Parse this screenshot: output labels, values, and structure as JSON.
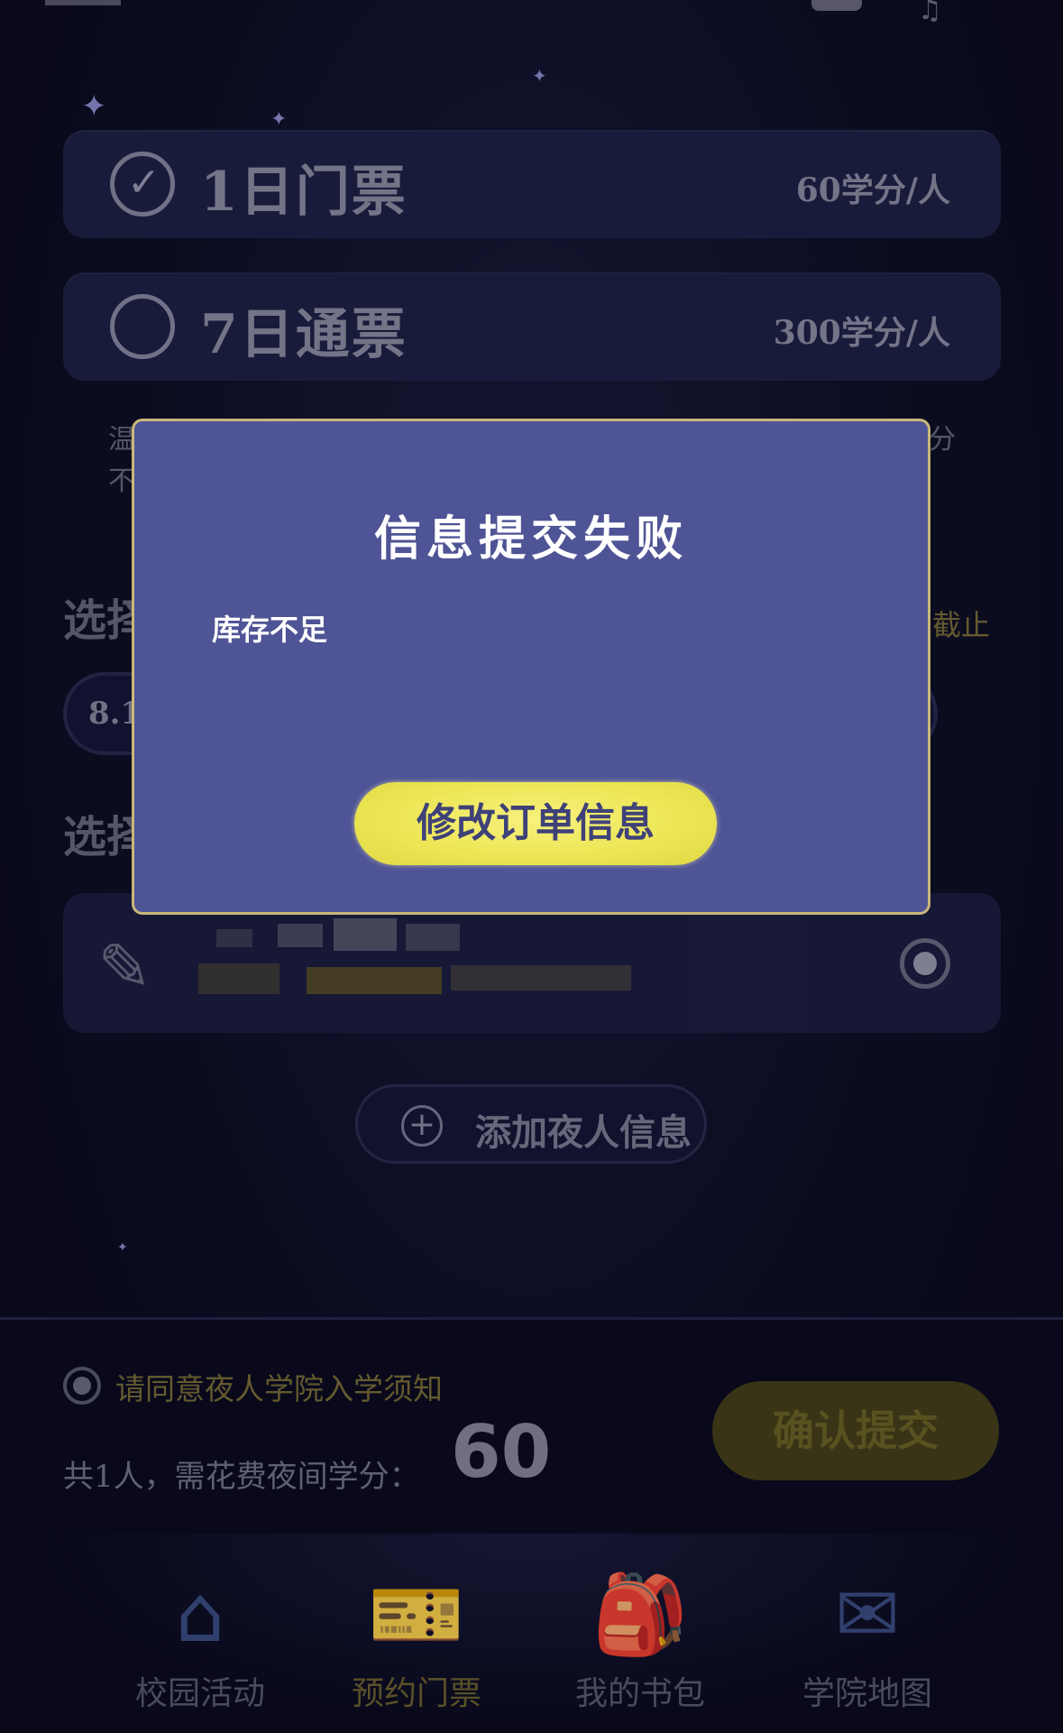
{
  "tickets": [
    {
      "name": "1日门票",
      "price": "60学分/人",
      "selected": true
    },
    {
      "name": "7日通票",
      "price": "300学分/人",
      "selected": false
    }
  ],
  "notice": {
    "line1_start": "温",
    "line1_end": "分",
    "line2_start": "不"
  },
  "date_section": {
    "heading": "选择",
    "deadline": "截止",
    "selected_date": "8.1"
  },
  "person_section": {
    "heading": "选择"
  },
  "add_person": {
    "label": "添加夜人信息"
  },
  "footer": {
    "agree_text": "请同意夜人学院入学须知",
    "total_text": "共1人，需花费夜间学分：",
    "total_value": "60",
    "confirm_label": "确认提交"
  },
  "tabs": [
    {
      "label": "校园活动",
      "icon": "home-icon",
      "active": false
    },
    {
      "label": "预约门票",
      "icon": "ticket-icon",
      "active": true
    },
    {
      "label": "我的书包",
      "icon": "backpack-icon",
      "active": false
    },
    {
      "label": "学院地图",
      "icon": "map-icon",
      "active": false
    }
  ],
  "modal": {
    "title": "信息提交失败",
    "message": "库存不足",
    "button_label": "修改订单信息"
  },
  "colors": {
    "modal_bg": "#4f5496",
    "modal_border": "#c9b77a",
    "modal_button": "#ece653",
    "page_bg": "#0f0f28"
  }
}
